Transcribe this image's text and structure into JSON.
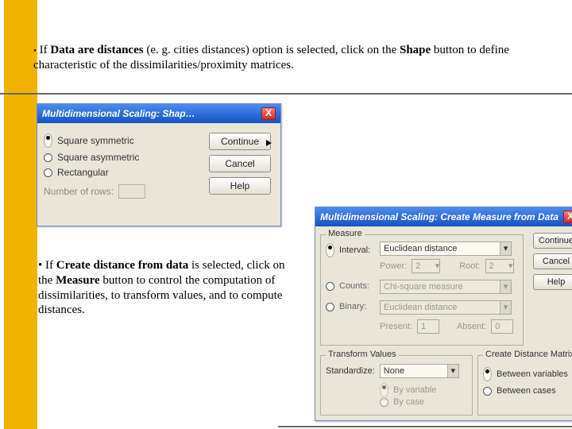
{
  "bullet1": {
    "pre": "If ",
    "b1": "Data are distances",
    "mid1": " (e. g. cities distances) option is selected, click on the ",
    "b2": "Shape",
    "mid2": " button to define characteristic of the dissimilarities/proximity matrices."
  },
  "bullet2": {
    "pre": "If ",
    "b1": "Create distance from data",
    "mid1": " is selected, click on the ",
    "b2": "Measure",
    "mid2": " button to control the computation of dissimilarities, to transform values, and to compute distances."
  },
  "dlg1": {
    "title": "Multidimensional Scaling: Shap…",
    "close": "X",
    "opt1": "Square symmetric",
    "opt2": "Square asymmetric",
    "opt3": "Rectangular",
    "numrows_label": "Number of rows:",
    "btn_continue": "Continue",
    "btn_cancel": "Cancel",
    "btn_help": "Help"
  },
  "dlg2": {
    "title": "Multidimensional Scaling: Create Measure from Data",
    "close": "X",
    "grp_measure": "Measure",
    "opt_interval": "Interval:",
    "opt_counts": "Counts:",
    "opt_binary": "Binary:",
    "sel_interval": "Euclidean distance",
    "lbl_power": "Power:",
    "val_power": "2",
    "lbl_root": "Root:",
    "val_root": "2",
    "sel_counts": "Chi-square measure",
    "sel_binary": "Euclidean distance",
    "lbl_present": "Present:",
    "val_present": "1",
    "lbl_absent": "Absent:",
    "val_absent": "0",
    "grp_transform": "Transform Values",
    "lbl_standardize": "Standardize:",
    "sel_standardize": "None",
    "opt_byvar": "By variable",
    "opt_bycase": "By case",
    "grp_matrix": "Create Distance Matrix",
    "opt_betvars": "Between variables",
    "opt_betcases": "Between cases",
    "btn_continue": "Continue",
    "btn_cancel": "Cancel",
    "btn_help": "Help"
  }
}
